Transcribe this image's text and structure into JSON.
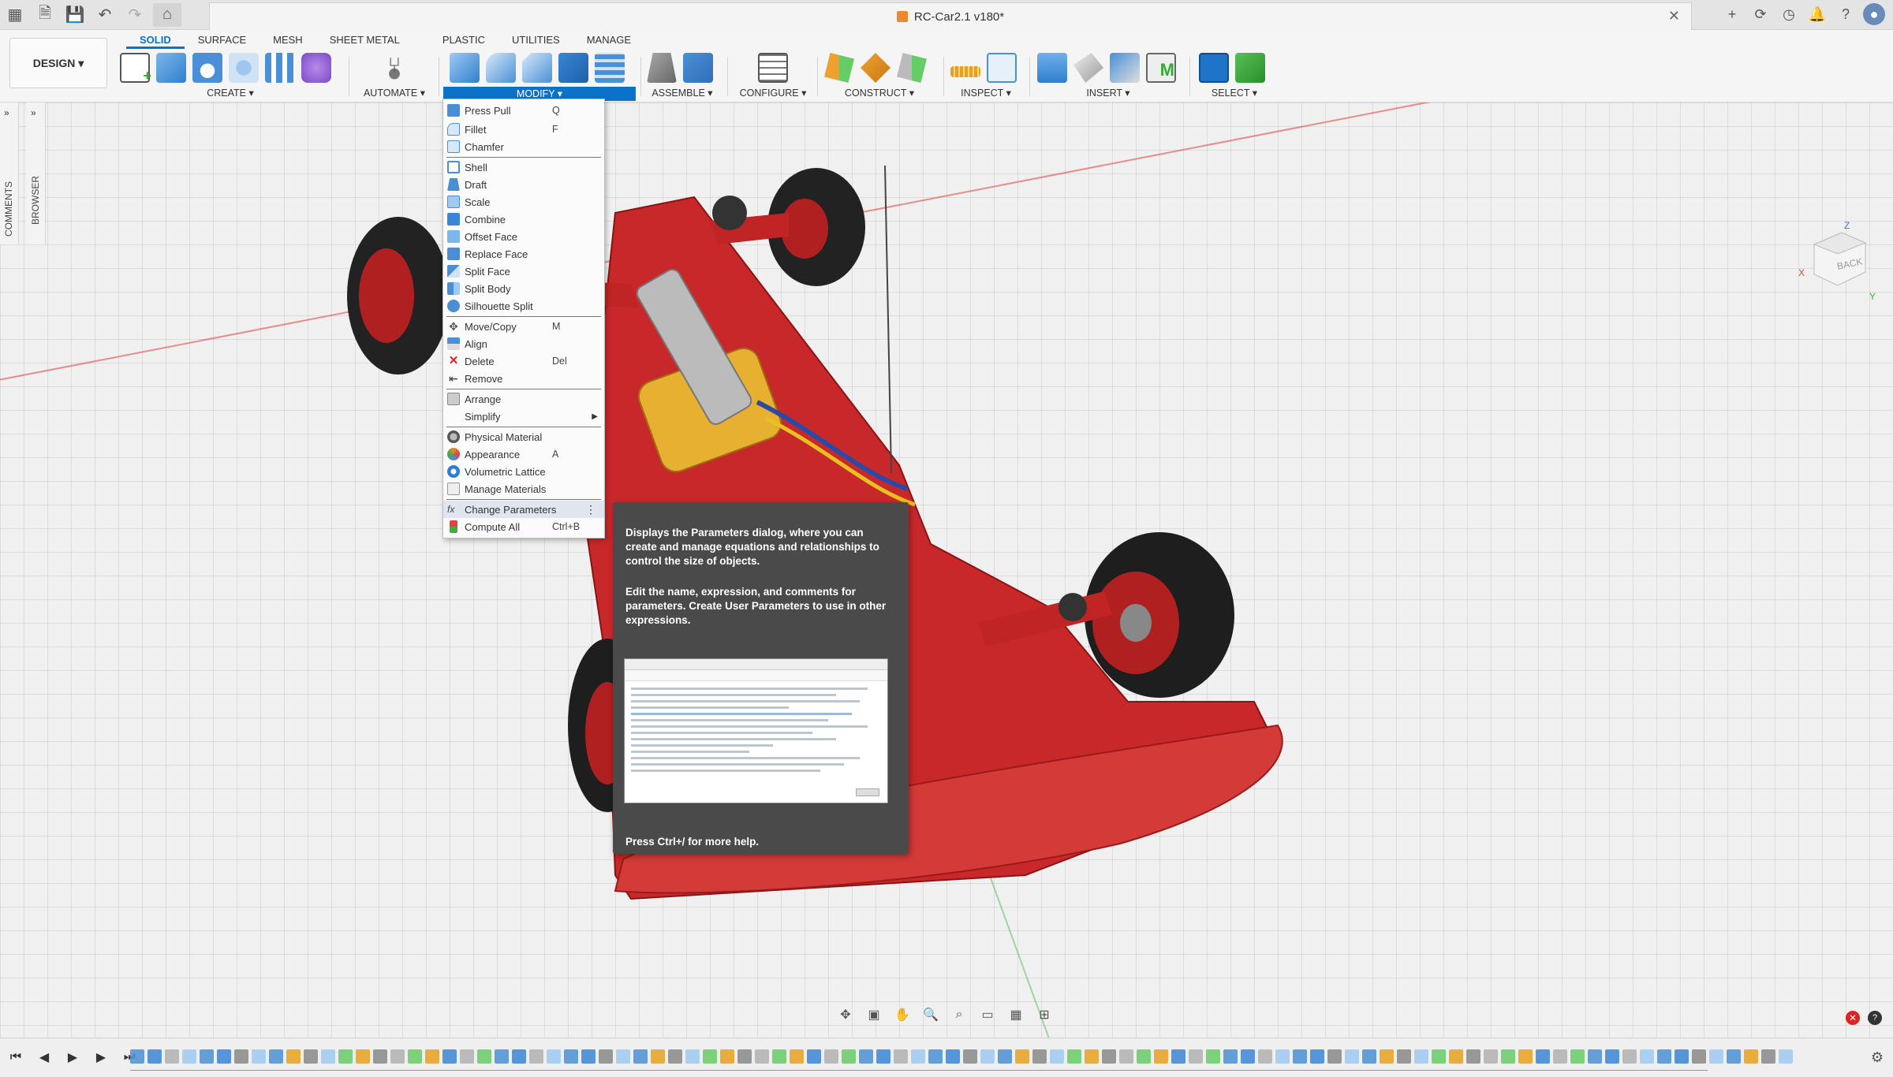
{
  "window": {
    "title": "RC-Car2.1 v180*"
  },
  "design_button": {
    "label": "DESIGN ▾"
  },
  "workspace_tabs": [
    "SOLID",
    "SURFACE",
    "MESH",
    "SHEET METAL",
    "PLASTIC",
    "UTILITIES",
    "MANAGE"
  ],
  "ribbon_groups": {
    "create": "CREATE ▾",
    "automate": "AUTOMATE ▾",
    "modify": "MODIFY ▾",
    "assemble": "ASSEMBLE ▾",
    "configure": "CONFIGURE ▾",
    "construct": "CONSTRUCT ▾",
    "inspect": "INSPECT ▾",
    "insert": "INSERT ▾",
    "select": "SELECT ▾"
  },
  "side_panels": {
    "comments": "COMMENTS",
    "browser": "BROWSER"
  },
  "modify_menu": [
    {
      "label": "Press Pull",
      "shortcut": "Q",
      "icon": "press-pull-icon",
      "color": "#4a8fd4"
    },
    {
      "label": "Fillet",
      "shortcut": "F",
      "icon": "fillet-icon",
      "color": "#4a8fd4"
    },
    {
      "label": "Chamfer",
      "shortcut": "",
      "icon": "chamfer-icon",
      "color": "#4a8fd4"
    },
    {
      "label": "Shell",
      "shortcut": "",
      "icon": "shell-icon",
      "color": "#4a8fd4"
    },
    {
      "label": "Draft",
      "shortcut": "",
      "icon": "draft-icon",
      "color": "#4a8fd4"
    },
    {
      "label": "Scale",
      "shortcut": "",
      "icon": "scale-icon",
      "color": "#4a8fd4"
    },
    {
      "label": "Combine",
      "shortcut": "",
      "icon": "combine-icon",
      "color": "#4a8fd4"
    },
    {
      "label": "Offset Face",
      "shortcut": "",
      "icon": "offset-face-icon",
      "color": "#4a8fd4"
    },
    {
      "label": "Replace Face",
      "shortcut": "",
      "icon": "replace-face-icon",
      "color": "#4a8fd4"
    },
    {
      "label": "Split Face",
      "shortcut": "",
      "icon": "split-face-icon",
      "color": "#4a8fd4"
    },
    {
      "label": "Split Body",
      "shortcut": "",
      "icon": "split-body-icon",
      "color": "#4a8fd4"
    },
    {
      "label": "Silhouette Split",
      "shortcut": "",
      "icon": "silhouette-split-icon",
      "color": "#4a8fd4"
    },
    {
      "label": "Move/Copy",
      "shortcut": "M",
      "icon": "move-copy-icon",
      "color": "#555555"
    },
    {
      "label": "Align",
      "shortcut": "",
      "icon": "align-icon",
      "color": "#4a8fd4"
    },
    {
      "label": "Delete",
      "shortcut": "Del",
      "icon": "delete-icon",
      "color": "#d22222"
    },
    {
      "label": "Remove",
      "shortcut": "",
      "icon": "remove-icon",
      "color": "#555555"
    },
    {
      "label": "Arrange",
      "shortcut": "",
      "icon": "arrange-icon",
      "color": "#888888"
    },
    {
      "label": "Simplify",
      "shortcut": "",
      "icon": "",
      "color": "",
      "submenu": "▶"
    },
    {
      "label": "Physical Material",
      "shortcut": "",
      "icon": "physical-material-icon",
      "color": "#777777"
    },
    {
      "label": "Appearance",
      "shortcut": "A",
      "icon": "appearance-icon",
      "color": "#e58a2a"
    },
    {
      "label": "Volumetric Lattice",
      "shortcut": "",
      "icon": "volumetric-lattice-icon",
      "color": "#2a7fd4"
    },
    {
      "label": "Manage Materials",
      "shortcut": "",
      "icon": "manage-materials-icon",
      "color": "#aaaaaa"
    },
    {
      "label": "Change Parameters",
      "shortcut": "",
      "icon": "fx-icon",
      "color": "#666666",
      "more": "⋮"
    },
    {
      "label": "Compute All",
      "shortcut": "Ctrl+B",
      "icon": "compute-all-icon",
      "color": "#d44"
    }
  ],
  "tooltip": {
    "para1": "Displays the Parameters dialog, where you can create and manage equations and relationships to control the size of objects.",
    "para2": "Edit the name, expression, and comments for parameters. Create User Parameters to use in other expressions.",
    "help": "Press Ctrl+/ for more help."
  }
}
